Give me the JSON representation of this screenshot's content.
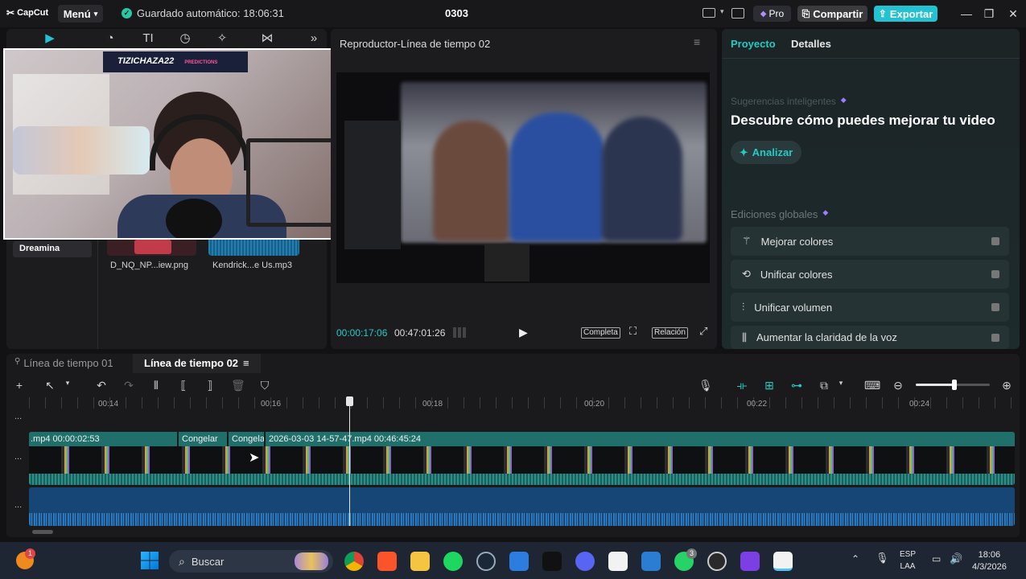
{
  "app": {
    "logo": "CapCut",
    "menu_label": "Menú",
    "autosave_status": "Guardado automático: 18:06:31",
    "project_name": "0303",
    "pro_label": "Pro",
    "share_label": "Compartir",
    "export_label": "Exportar",
    "accent_color": "#22c2d3"
  },
  "media": {
    "overlay_banner": "TIZICHAZA22",
    "overlay_sub": "PREDICTIONS",
    "sidebar_item": "Dreamina",
    "items": [
      {
        "label": "D_NQ_NP...iew.png"
      },
      {
        "label": "Kendrick...e Us.mp3"
      }
    ]
  },
  "player": {
    "title": "Reproductor-Línea de tiempo 02",
    "current_time": "00:00:17:06",
    "total_time": "00:47:01:26",
    "full_label": "Completa",
    "ratio_label": "Relación"
  },
  "right_panel": {
    "tab_project": "Proyecto",
    "tab_details": "Detalles",
    "smart_suggestions": "Sugerencias inteligentes",
    "headline": "Descubre cómo puedes mejorar tu video",
    "analyze_label": "Analizar",
    "global_edits": "Ediciones globales",
    "items": [
      {
        "label": "Mejorar colores"
      },
      {
        "label": "Unificar colores"
      },
      {
        "label": "Unificar volumen"
      },
      {
        "label": "Aumentar la claridad de la voz"
      }
    ]
  },
  "timeline": {
    "tabs": [
      {
        "label": "Línea de tiempo 01"
      },
      {
        "label": "Línea de tiempo 02"
      }
    ],
    "ruler": [
      "00:14",
      "00:16",
      "00:18",
      "00:20",
      "00:22",
      "00:24"
    ],
    "clips": [
      {
        "label": ".mp4  00:00:02:53"
      },
      {
        "label": "Congelar"
      },
      {
        "label": "Congela"
      },
      {
        "label": "2026-03-03 14-57-47.mp4   00:46:45:24"
      }
    ],
    "track_dots": "..."
  },
  "taskbar": {
    "search_label": "Buscar",
    "lang_line1": "ESP",
    "lang_line2": "LAA",
    "clock_time": "18:06",
    "clock_date": "4/3/2026",
    "notify_badge": "1",
    "whatsapp_badge": "3"
  }
}
